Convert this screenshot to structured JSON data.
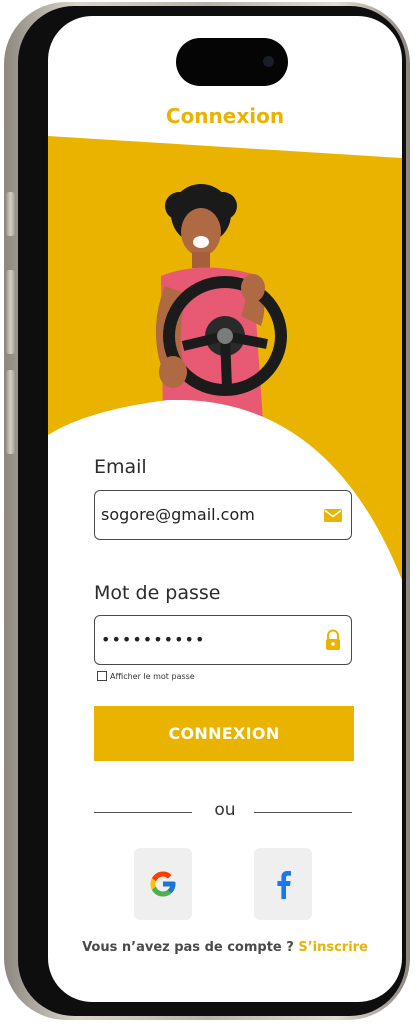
{
  "header": {
    "title": "Connexion"
  },
  "form": {
    "email_label": "Email",
    "email_value": "sogore@gmail.com",
    "password_label": "Mot de passe",
    "password_value": "••••••••••",
    "show_password_label": "Afficher le mot passe",
    "submit_label": "CONNEXION"
  },
  "divider": {
    "text": "ou"
  },
  "social": {
    "google_icon": "google-icon",
    "facebook_icon": "facebook-icon"
  },
  "footer": {
    "prompt": "Vous n’avez pas de compte ?",
    "signup_link": "S’inscrire"
  },
  "colors": {
    "accent": "#e9b300",
    "input_border": "#4a4a4a",
    "social_bg": "#efefef"
  }
}
